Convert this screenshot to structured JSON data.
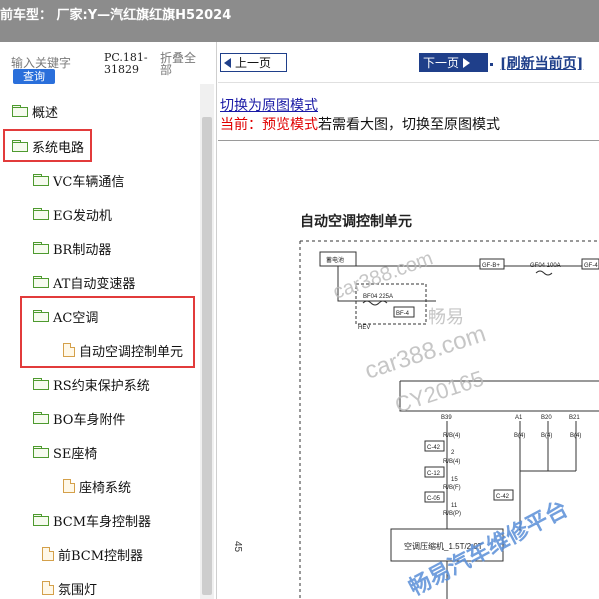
{
  "window": {
    "title": "前车型： 厂家:Y—汽红旗红旗H52024"
  },
  "sidebar": {
    "search_label": "输入关键字",
    "search_button": "查询",
    "pc_code": "PC.181-31829",
    "collapse_all": "折叠全部",
    "items": [
      {
        "label": "概述",
        "icon": "folder-icon"
      },
      {
        "label": "系统电路",
        "icon": "folder-open-icon"
      },
      {
        "label": "VC车辆通信",
        "icon": "folder-icon"
      },
      {
        "label": "EG发动机",
        "icon": "folder-icon"
      },
      {
        "label": "BR制动器",
        "icon": "folder-icon"
      },
      {
        "label": "AT自动变速器",
        "icon": "folder-icon"
      },
      {
        "label": "AC空调",
        "icon": "folder-open-icon"
      },
      {
        "label": "自动空调控制单元",
        "icon": "document-icon"
      },
      {
        "label": "RS约束保护系统",
        "icon": "folder-icon"
      },
      {
        "label": "BO车身附件",
        "icon": "folder-icon"
      },
      {
        "label": "SE座椅",
        "icon": "folder-icon"
      },
      {
        "label": "座椅系统",
        "icon": "document-icon"
      },
      {
        "label": "BCM车身控制器",
        "icon": "folder-icon"
      },
      {
        "label": "前BCM控制器",
        "icon": "document-icon"
      },
      {
        "label": "氛围灯",
        "icon": "document-icon"
      }
    ]
  },
  "toolbar": {
    "prev_label": "上一页",
    "next_label": "下一页",
    "refresh_label": "[刷新当前页]"
  },
  "mode": {
    "switch_link": "切换为原图模式",
    "current_prefix": "当前：",
    "current_mode": "预览模式",
    "hint": "若需看大图，切换至原图模式"
  },
  "diagram": {
    "title": "自动空调控制单元",
    "battery": "蓄电池",
    "fuse_bf04": "BF04 225A",
    "fuse_bf4": "BF-4",
    "hev": "HEV",
    "gf_b_plus": "GF-B+",
    "gf04": "GF04 100A",
    "gf_4": "GF-4",
    "pins": [
      "B39",
      "A1",
      "B20",
      "B21"
    ],
    "wire_rb4": "R/B(4)",
    "wire_b4": "B(4)",
    "c42": "C-42",
    "c12": "C-12",
    "c05": "C-05",
    "n2": "2",
    "n15": "15",
    "n11": "11",
    "rbf": "R/B(F)",
    "rbp": "R/B(P)",
    "compressor": "空调压缩机_1.5T/2.0T",
    "page_number": "45",
    "watermarks": [
      "car388.com",
      "畅易",
      "car388.com",
      "CY20165",
      "畅易汽车维修平台"
    ]
  }
}
